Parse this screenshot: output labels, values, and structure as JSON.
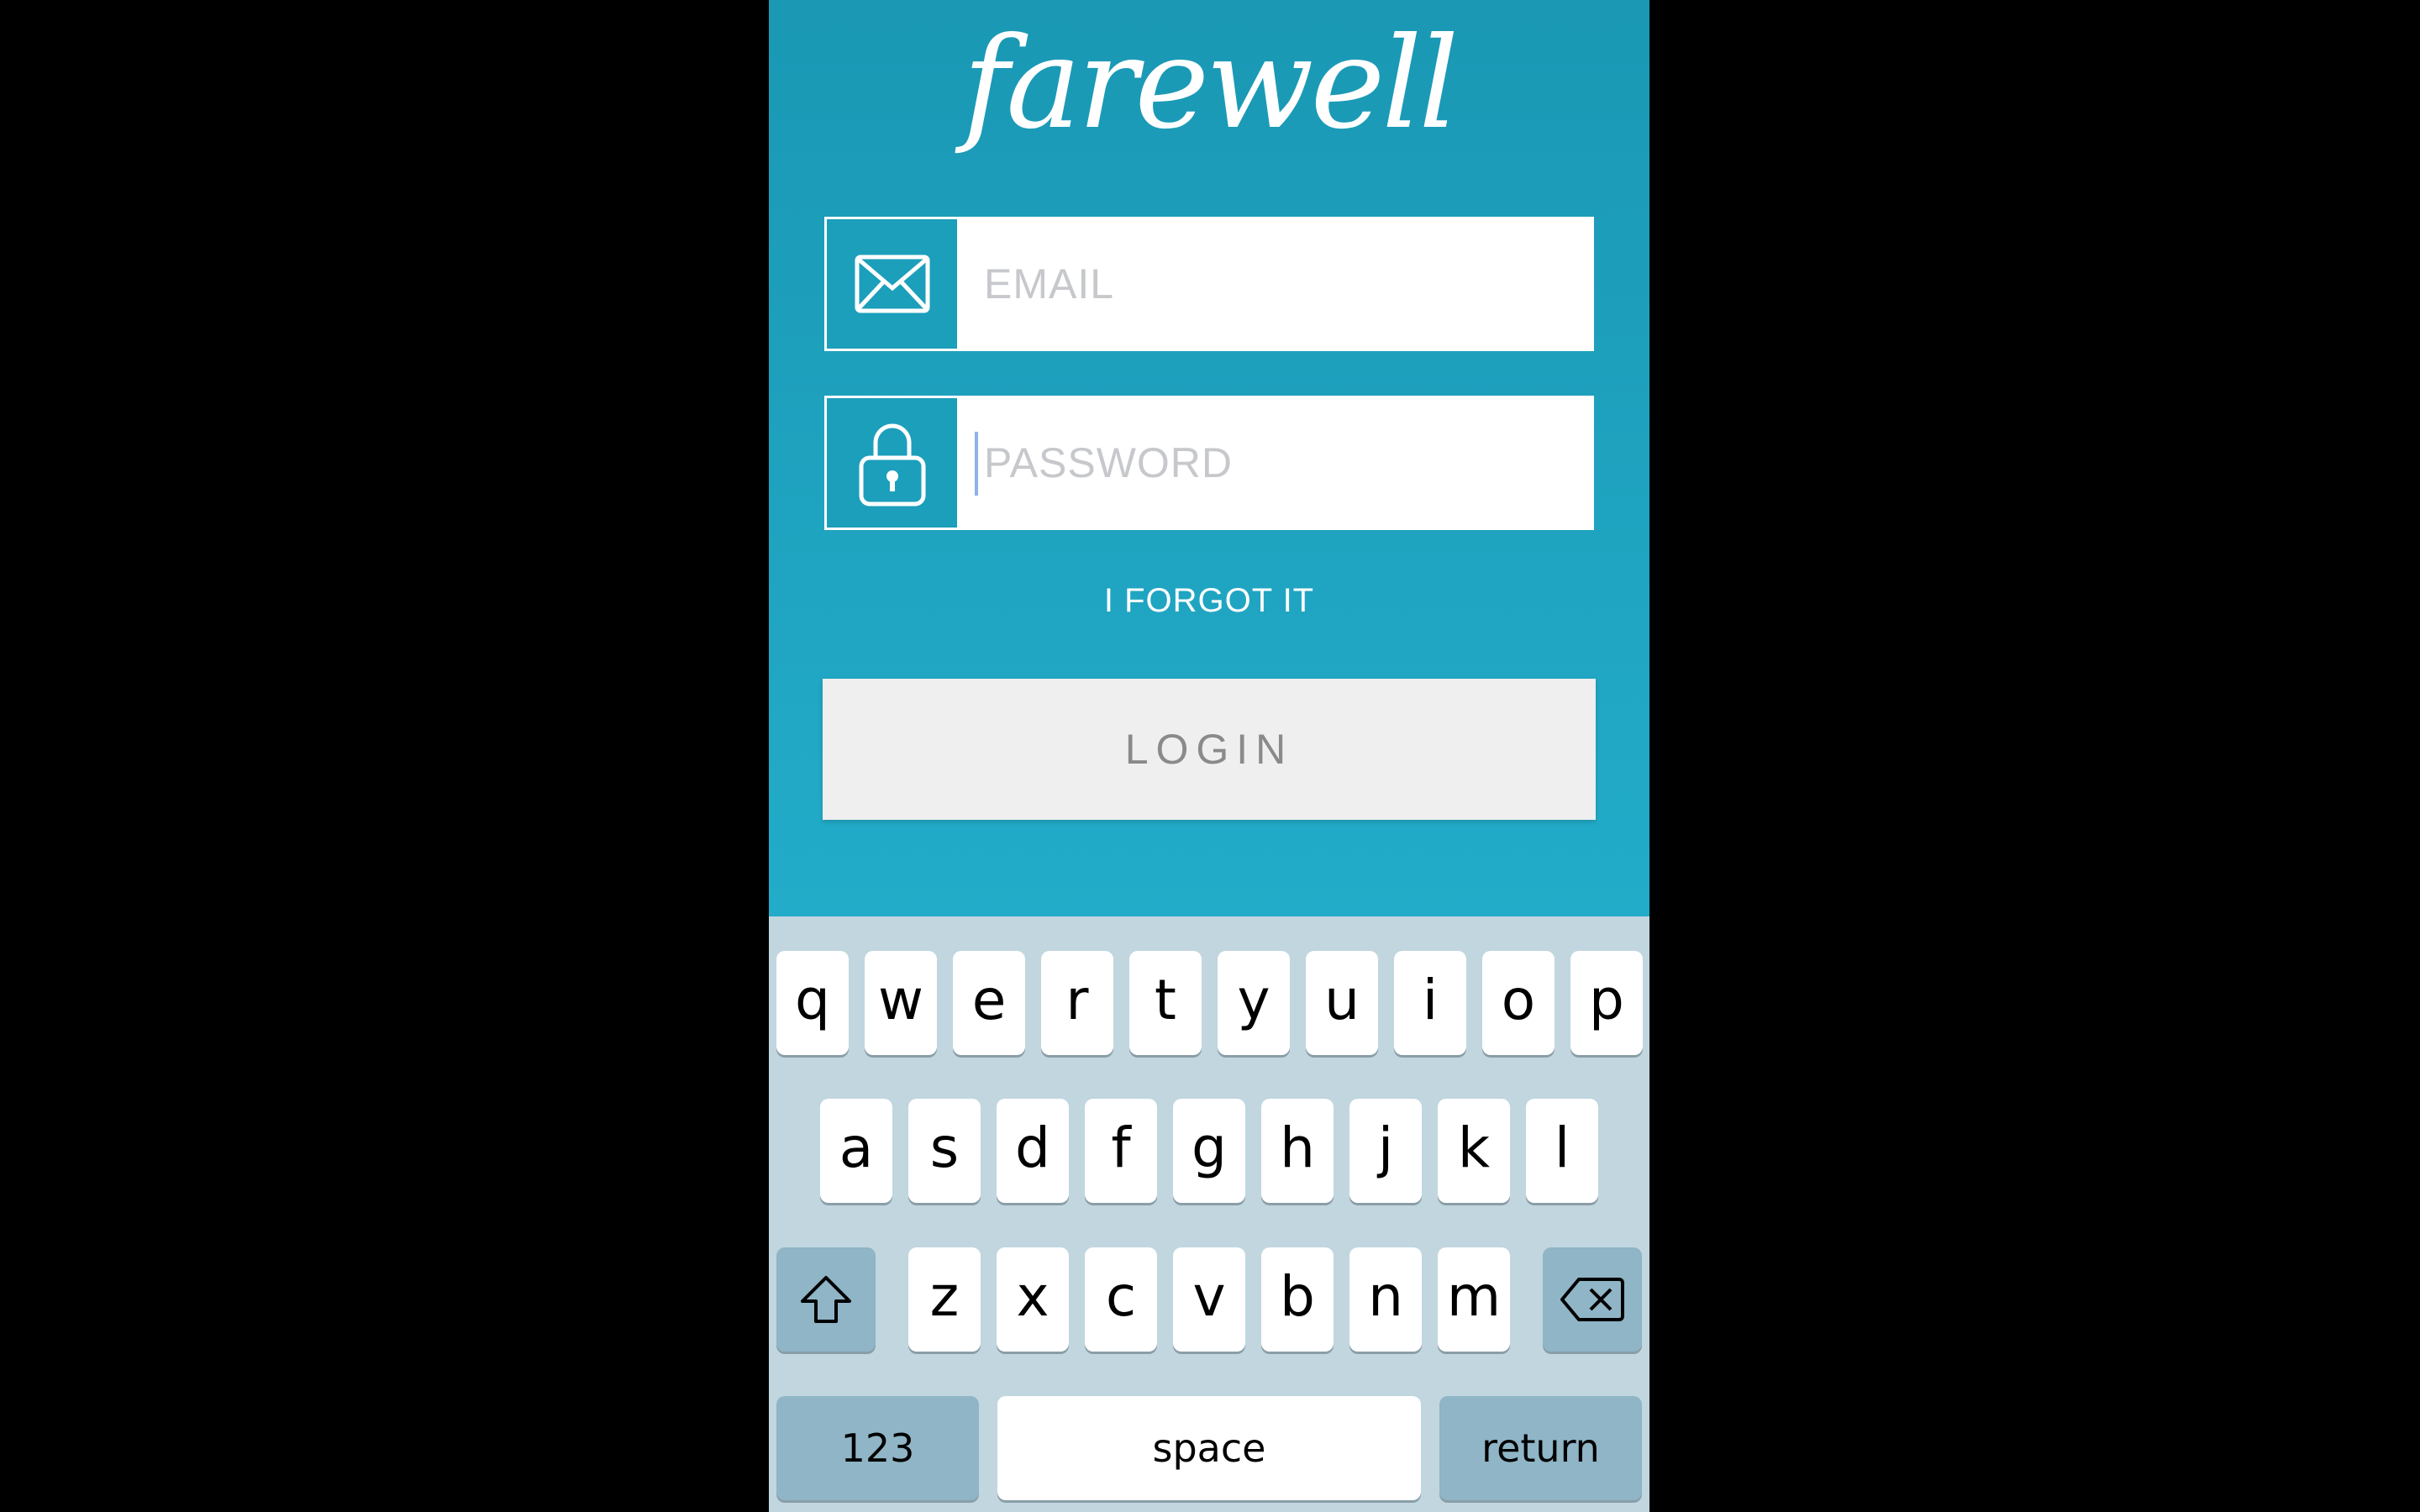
{
  "app": {
    "logo_text": "farewell",
    "email_placeholder": "EMAIL",
    "password_placeholder": "PASSWORD",
    "forgot_label": "I FORGOT IT",
    "login_label": "LOGIN",
    "colors": {
      "background_top": "#1a98b4",
      "background_bottom": "#22acc9",
      "icon_box": "#1c9fbb",
      "login_button_bg": "#efefef"
    },
    "icons": {
      "email": "envelope-icon",
      "password": "lock-icon"
    }
  },
  "keyboard": {
    "row1": [
      "q",
      "w",
      "e",
      "r",
      "t",
      "y",
      "u",
      "i",
      "o",
      "p"
    ],
    "row2": [
      "a",
      "s",
      "d",
      "f",
      "g",
      "h",
      "j",
      "k",
      "l"
    ],
    "row3": [
      "z",
      "x",
      "c",
      "v",
      "b",
      "n",
      "m"
    ],
    "shift_icon": "shift-icon",
    "delete_icon": "delete-icon",
    "numbers_label": "123",
    "space_label": "space",
    "return_label": "return"
  }
}
